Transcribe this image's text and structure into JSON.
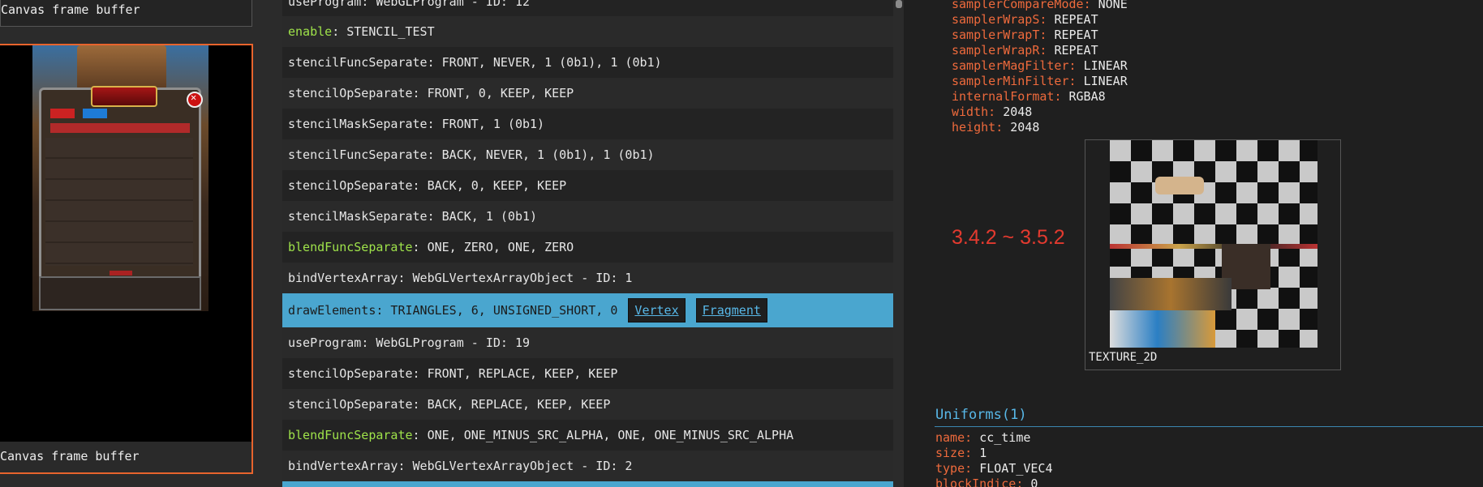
{
  "left_panel": {
    "top_label": "Canvas frame buffer",
    "bottom_label": "Canvas frame buffer"
  },
  "command_list": {
    "items": [
      {
        "fn": "useProgram",
        "args": ": WebGLProgram - ID: 12",
        "style": "partial"
      },
      {
        "fn": "enable",
        "args": ": STENCIL_TEST",
        "style": "green"
      },
      {
        "fn": "stencilFuncSeparate",
        "args": ": FRONT, NEVER, 1 (0b1), 1 (0b1)",
        "style": "normal"
      },
      {
        "fn": "stencilOpSeparate",
        "args": ": FRONT, 0, KEEP, KEEP",
        "style": "normal"
      },
      {
        "fn": "stencilMaskSeparate",
        "args": ": FRONT, 1 (0b1)",
        "style": "normal"
      },
      {
        "fn": "stencilFuncSeparate",
        "args": ": BACK, NEVER, 1 (0b1), 1 (0b1)",
        "style": "normal"
      },
      {
        "fn": "stencilOpSeparate",
        "args": ": BACK, 0, KEEP, KEEP",
        "style": "normal"
      },
      {
        "fn": "stencilMaskSeparate",
        "args": ": BACK, 1 (0b1)",
        "style": "normal"
      },
      {
        "fn": "blendFuncSeparate",
        "args": ": ONE, ZERO, ONE, ZERO",
        "style": "green"
      },
      {
        "fn": "bindVertexArray",
        "args": ": WebGLVertexArrayObject - ID: 1",
        "style": "normal"
      },
      {
        "fn": "drawElements",
        "args": ": TRIANGLES, 6, UNSIGNED_SHORT, 0",
        "style": "draw",
        "links": [
          "Vertex",
          "Fragment"
        ]
      },
      {
        "fn": "useProgram",
        "args": ": WebGLProgram - ID: 19",
        "style": "normal"
      },
      {
        "fn": "stencilOpSeparate",
        "args": ": FRONT, REPLACE, KEEP, KEEP",
        "style": "normal"
      },
      {
        "fn": "stencilOpSeparate",
        "args": ": BACK, REPLACE, KEEP, KEEP",
        "style": "normal"
      },
      {
        "fn": "blendFuncSeparate",
        "args": ": ONE, ONE_MINUS_SRC_ALPHA, ONE, ONE_MINUS_SRC_ALPHA",
        "style": "green"
      },
      {
        "fn": "bindVertexArray",
        "args": ": WebGLVertexArrayObject - ID: 2",
        "style": "normal"
      }
    ]
  },
  "texture_props": [
    {
      "key": "samplerCompareMode",
      "value": "NONE"
    },
    {
      "key": "samplerWrapS",
      "value": "REPEAT"
    },
    {
      "key": "samplerWrapT",
      "value": "REPEAT"
    },
    {
      "key": "samplerWrapR",
      "value": "REPEAT"
    },
    {
      "key": "samplerMagFilter",
      "value": "LINEAR"
    },
    {
      "key": "samplerMinFilter",
      "value": "LINEAR"
    },
    {
      "key": "internalFormat",
      "value": "RGBA8"
    },
    {
      "key": "width",
      "value": "2048"
    },
    {
      "key": "height",
      "value": "2048"
    }
  ],
  "texture_label": "TEXTURE_2D",
  "version_annotation": "3.4.2 ~ 3.5.2",
  "uniforms": {
    "title": "Uniforms(1)",
    "props": [
      {
        "key": "name",
        "value": "cc_time"
      },
      {
        "key": "size",
        "value": "1"
      },
      {
        "key": "type",
        "value": "FLOAT_VEC4"
      },
      {
        "key": "blockIndice",
        "value": "0"
      }
    ]
  },
  "colors": {
    "accent_orange": "#e8642d",
    "highlight_blue": "#4aa6cf",
    "function_green": "#9fe34a",
    "property_key": "#ee6a3c",
    "link_blue": "#58b8e8",
    "version_red": "#e33a2f"
  }
}
